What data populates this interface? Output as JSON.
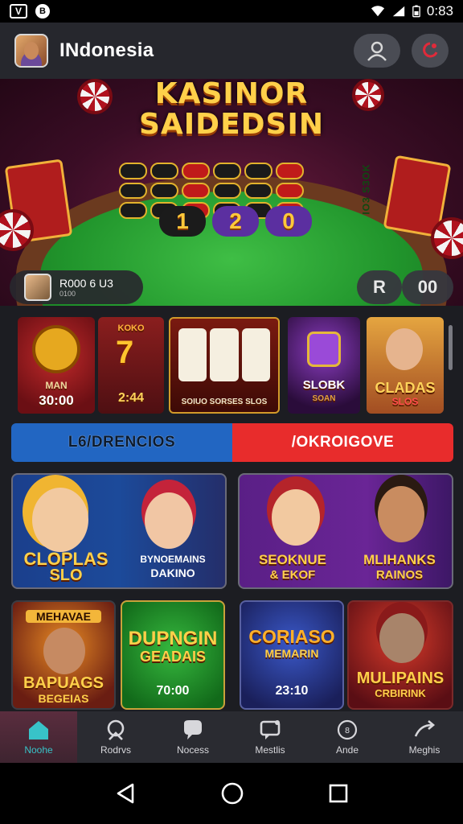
{
  "status_bar": {
    "time": "0:83",
    "badge_left": "V",
    "circle_left": "B"
  },
  "app_bar": {
    "title": "INdonesia"
  },
  "hero": {
    "title_line1": "KASINOR",
    "title_line2": "SAIDEDSIN",
    "numbers": [
      "1",
      "2",
      "0"
    ],
    "side_text": "IO3 S3OK",
    "user_amount": "R000 6 U3",
    "user_sub": "0100",
    "btn_right_a": "R",
    "btn_right_b": "00"
  },
  "tiles": [
    {
      "line1": "MAN",
      "line2": "30:00"
    },
    {
      "line1": "KOKO",
      "line2": "2:44"
    },
    {
      "line1": "SOIUO SORSES SLOS"
    },
    {
      "line1": "SLOBK",
      "line2": "SOAN"
    },
    {
      "line1": "CLADAS",
      "line2": "SLOS"
    }
  ],
  "tabs": {
    "left": "L6/DRENCIOS",
    "right": "/OKROIGOVE"
  },
  "banners": {
    "left_a": "CLOPLAS",
    "left_b": "SLO",
    "left_c": "BYNOEMAINS",
    "left_d": "DAKINO",
    "right_a": "SEOKNUE",
    "right_b": "& EKOF",
    "right_c": "MLIHANKS",
    "right_d": "RAINOS"
  },
  "cards": [
    {
      "title": "MEHAVAE",
      "title2": "BAPUAGS",
      "sub": "BEGEIAS"
    },
    {
      "title": "DUPNGIN",
      "title2": "GEADAIS",
      "sub": "70:00"
    },
    {
      "title": "CORIASO",
      "title2": "MEMARIN",
      "sub": "23:10"
    },
    {
      "title": "MULIPAINS",
      "title2": "CRBIRINK",
      "sub": ""
    }
  ],
  "bottom_nav": [
    {
      "label": "Noohe",
      "icon": "home-icon"
    },
    {
      "label": "Rodrvs",
      "icon": "shield-icon"
    },
    {
      "label": "Nocess",
      "icon": "chat-icon"
    },
    {
      "label": "Mestlis",
      "icon": "message-icon"
    },
    {
      "label": "Ande",
      "icon": "coin-icon"
    },
    {
      "label": "Meghis",
      "icon": "share-icon"
    }
  ]
}
